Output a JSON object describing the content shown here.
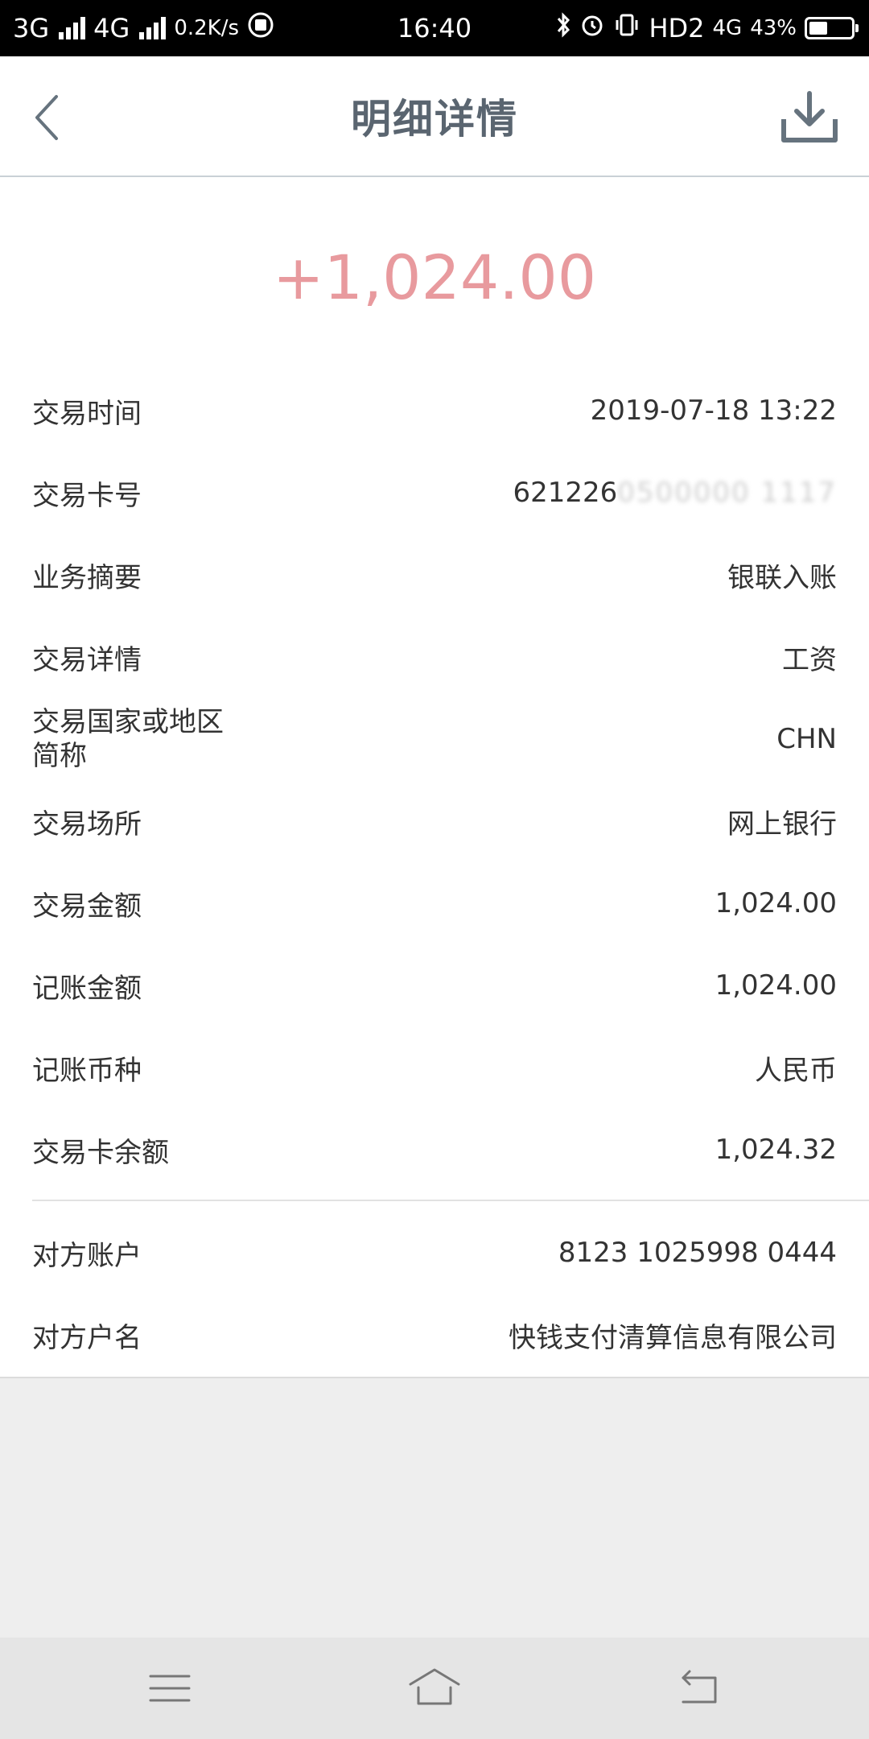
{
  "status_bar": {
    "network1": "3G",
    "network2": "4G",
    "speed": "0.2K/s",
    "time": "16:40",
    "hd": "HD2",
    "network3": "4G",
    "battery_percent": "43%",
    "battery_level": 0.43
  },
  "header": {
    "title": "明细详情",
    "back_icon": "chevron-left-icon",
    "download_icon": "download-icon"
  },
  "amount": "+1,024.00",
  "colors": {
    "amount": "#e89a9e",
    "title": "#5a6570",
    "icon": "#66737e"
  },
  "details": [
    {
      "label": "交易时间",
      "value": "2019-07-18 13:22"
    },
    {
      "label": "交易卡号",
      "value": "621226",
      "value_masked": "0500000 1117"
    },
    {
      "label": "业务摘要",
      "value": "银联入账"
    },
    {
      "label": "交易详情",
      "value": "工资"
    },
    {
      "label_line1": "交易国家或地区",
      "label_line2": "简称",
      "value": "CHN"
    },
    {
      "label": "交易场所",
      "value": "网上银行"
    },
    {
      "label": "交易金额",
      "value": "1,024.00"
    },
    {
      "label": "记账金额",
      "value": "1,024.00"
    },
    {
      "label": "记账币种",
      "value": "人民币"
    },
    {
      "label": "交易卡余额",
      "value": "1,024.32"
    }
  ],
  "counterparty": [
    {
      "label": "对方账户",
      "value": "8123 1025998 0444"
    },
    {
      "label": "对方户名",
      "value": "快钱支付清算信息有限公司"
    }
  ],
  "bottom_nav": {
    "menu_icon": "menu-icon",
    "home_icon": "home-icon",
    "back_icon": "back-icon"
  }
}
